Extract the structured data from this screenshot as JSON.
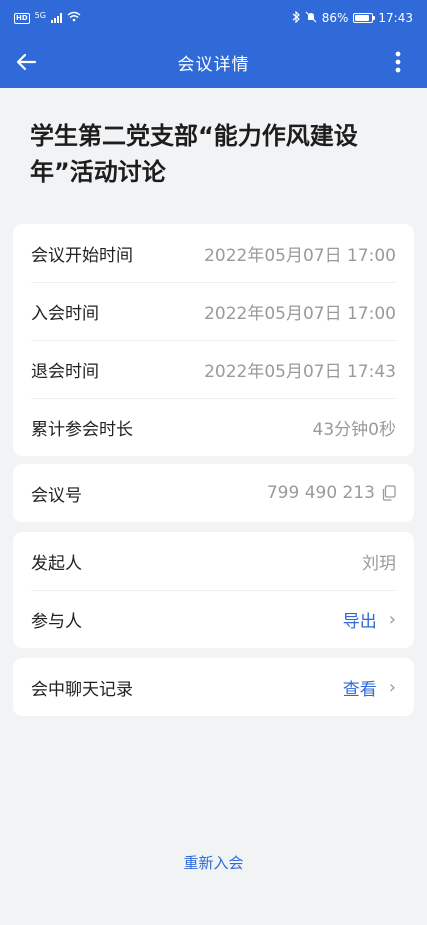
{
  "status_bar": {
    "hd": "HD",
    "network": "5G",
    "battery": "86%",
    "time": "17:43"
  },
  "app_bar": {
    "title": "会议详情",
    "back_icon": "arrow-left-icon",
    "more_icon": "more-vertical-icon"
  },
  "meeting": {
    "title": "学生第二党支部“能力作风建设年”活动讨论"
  },
  "time_card": {
    "start_label": "会议开始时间",
    "start_value": "2022年05月07日 17:00",
    "join_label": "入会时间",
    "join_value": "2022年05月07日 17:00",
    "leave_label": "退会时间",
    "leave_value": "2022年05月07日 17:43",
    "duration_label": "累计参会时长",
    "duration_value": "43分钟0秒"
  },
  "id_card": {
    "label": "会议号",
    "value": "799 490 213",
    "copy_icon": "copy-icon"
  },
  "people_card": {
    "host_label": "发起人",
    "host_value": "刘玥",
    "participants_label": "参与人",
    "participants_action": "导出"
  },
  "chat_card": {
    "label": "会中聊天记录",
    "action": "查看"
  },
  "footer": {
    "rejoin_label": "重新入会"
  },
  "colors": {
    "primary": "#2f6ad8",
    "background": "#f2f3f5",
    "muted_text": "#9a9a9a"
  }
}
